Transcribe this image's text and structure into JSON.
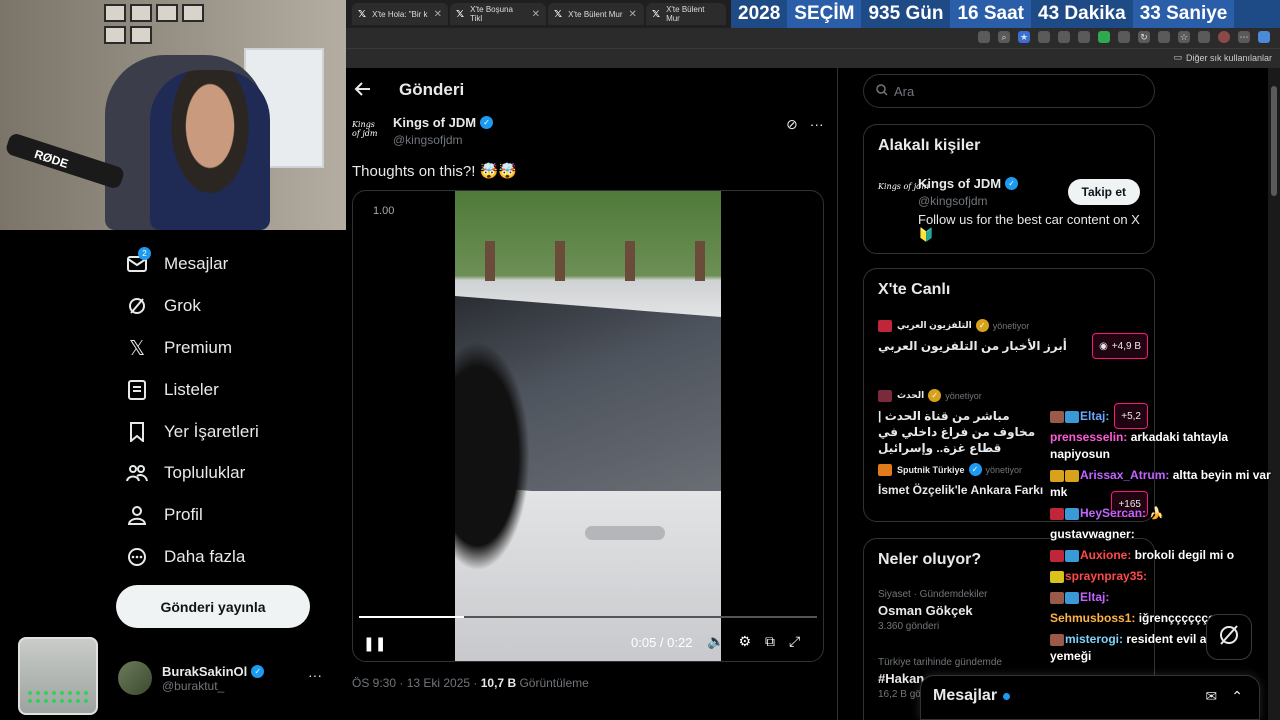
{
  "tabs": [
    {
      "label": "X'te Hola: \"Bir k"
    },
    {
      "label": "X'te Boşuna Tikl"
    },
    {
      "label": "X'te Bülent Mur"
    },
    {
      "label": "X'te Bülent Mur"
    }
  ],
  "countdown": {
    "year": "2028",
    "label": "SEÇİM",
    "days": "935 Gün",
    "hours": "16 Saat",
    "minutes": "43 Dakika",
    "seconds": "33 Saniye"
  },
  "bookmarks": {
    "other": "Diğer sık kullanılanlar"
  },
  "webcam": {
    "mic_brand": "RØDE"
  },
  "nav": {
    "messages": "Mesajlar",
    "messages_badge": "2",
    "grok": "Grok",
    "premium": "Premium",
    "lists": "Listeler",
    "bookmarks": "Yer İşaretleri",
    "communities": "Topluluklar",
    "profile": "Profil",
    "more": "Daha fazla"
  },
  "post_button": "Gönderi yayınla",
  "user": {
    "name": "BurakSakinOl",
    "handle": "@buraktut_"
  },
  "main": {
    "title": "Gönderi",
    "author": {
      "name": "Kings of JDM",
      "handle": "@kingsofjdm",
      "logo": "Kings of jdm"
    },
    "text": "Thoughts on this?! 🤯🤯",
    "video": {
      "speed": "1.00",
      "time": "0:05 / 0:22",
      "progress_fraction": 0.23
    },
    "meta": {
      "time": "ÖS 9:30 · 13 Eki 2025 · ",
      "views": "10,7 B",
      "views_label": " Görüntüleme"
    }
  },
  "right": {
    "search_placeholder": "Ara",
    "relevant": {
      "title": "Alakalı kişiler",
      "name": "Kings of JDM",
      "handle": "@kingsofjdm",
      "bio": "Follow us for the best car content on X 🔰",
      "follow": "Takip et"
    },
    "live": {
      "title": "X'te Canlı",
      "items": [
        {
          "source": "التلفزيون العربي",
          "role": "yönetiyor",
          "title": "أبرز الأخبار من التلفزيون العربي",
          "count": "+4,9 B"
        },
        {
          "source": "الحدث",
          "role": "yönetiyor",
          "title": "مباشر من قناة الحدث | مخاوف من فراغ داخلي في قطاع غزة.. وإسرائيل",
          "count": "+5,2"
        },
        {
          "source": "Sputnik Türkiye",
          "role": "yönetiyor",
          "title": "İsmet Özçelik'le Ankara Farkı",
          "count": "+165"
        }
      ]
    },
    "trends": {
      "title": "Neler oluyor?",
      "items": [
        {
          "category": "Siyaset · Gündemdekiler",
          "name": "Osman Gökçek",
          "posts": "3.360 gönderi"
        },
        {
          "category": "Türkiye tarihinde gündemde",
          "name": "#Hakan",
          "posts": "16,2 B gönderi"
        }
      ]
    }
  },
  "chat": [
    {
      "user": "Eltaj:",
      "text": "",
      "cls": "u3"
    },
    {
      "user": "prensesselin:",
      "text": " arkadaki tahtayla napiyosun",
      "cls": "u2"
    },
    {
      "user": "Arissax_Atrum:",
      "text": " altta beyin mi var mk",
      "cls": "u1"
    },
    {
      "user": "HeySercan:",
      "text": " 🍌",
      "cls": "u1"
    },
    {
      "user": "gustavwagner:",
      "text": " ",
      "cls": "u0"
    },
    {
      "user": "Auxione:",
      "text": " brokoli degil mi o",
      "cls": "u4"
    },
    {
      "user": "spraynpray35:",
      "text": " ",
      "cls": "u4"
    },
    {
      "user": "Eltaj:",
      "text": " ",
      "cls": "u1"
    },
    {
      "user": "Sehmusboss1:",
      "text": " iğrençççççççç",
      "cls": "u5"
    },
    {
      "user": "misterogi:",
      "text": " resident evil akşam yemeği",
      "cls": "u6"
    }
  ],
  "drawer": {
    "title": "Mesajlar"
  },
  "colors": {
    "accent": "#1d9bf0",
    "live": "#f91880",
    "countdown_bg": "#1e4a86"
  }
}
